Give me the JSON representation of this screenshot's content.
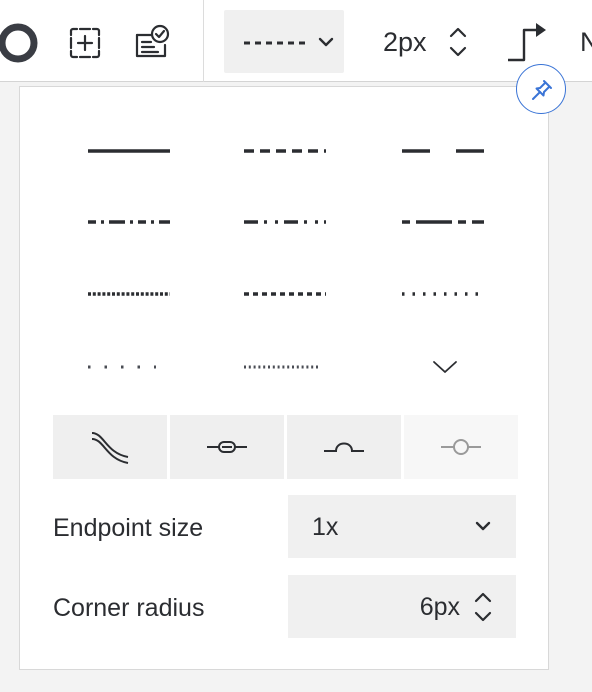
{
  "toolbar": {
    "icons": {
      "fill": "circle-fill-icon",
      "frame": "frame-crosshair-icon",
      "approve": "checked-card-icon",
      "style": "dashed-line-style-icon",
      "chevron": "chevron-down-icon",
      "stepper": "stepper-icon",
      "connector": "elbow-connector-icon",
      "pin": "pin-icon"
    },
    "stroke_width": "2px",
    "truncated_label": "N"
  },
  "line_styles": [
    "solid",
    "dashed",
    "long-dashed",
    "dash-dot",
    "dash-dot-dot",
    "long-dash-short",
    "dense-dotted",
    "short-dashed",
    "dotted",
    "sparse-dotted",
    "fine-dotted"
  ],
  "routing_options": [
    "curved-icon",
    "linked-icon",
    "jump-over-icon",
    "node-icon"
  ],
  "endpoint_size": {
    "label": "Endpoint size",
    "value": "1x"
  },
  "corner_radius": {
    "label": "Corner radius",
    "value": "6px"
  },
  "colors": {
    "accent": "#3a74d6",
    "text": "#2b2d31",
    "control_bg": "#f0f0f0"
  }
}
